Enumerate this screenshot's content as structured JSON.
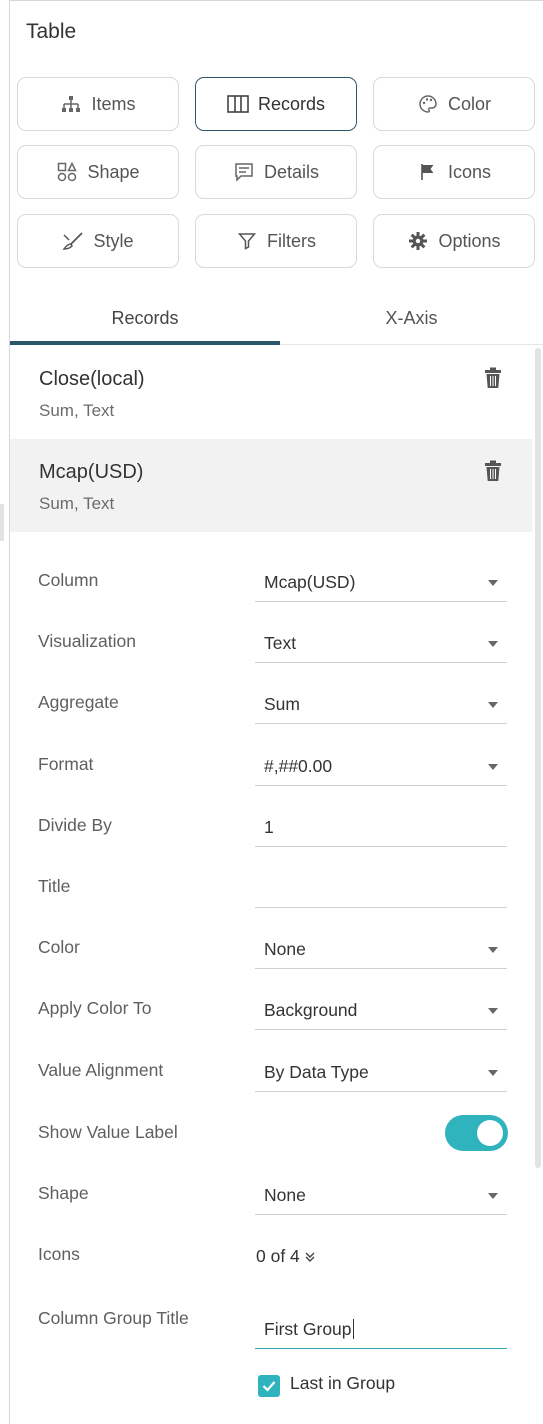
{
  "panel": {
    "title": "Table"
  },
  "buttons": [
    {
      "key": "items",
      "label": "Items",
      "icon": "hierarchy-icon",
      "active": false
    },
    {
      "key": "records",
      "label": "Records",
      "icon": "columns-icon",
      "active": true
    },
    {
      "key": "color",
      "label": "Color",
      "icon": "palette-icon",
      "active": false
    },
    {
      "key": "shape",
      "label": "Shape",
      "icon": "shapes-icon",
      "active": false
    },
    {
      "key": "details",
      "label": "Details",
      "icon": "comment-icon",
      "active": false
    },
    {
      "key": "icons",
      "label": "Icons",
      "icon": "flag-icon",
      "active": false
    },
    {
      "key": "style",
      "label": "Style",
      "icon": "brush-icon",
      "active": false
    },
    {
      "key": "filters",
      "label": "Filters",
      "icon": "filter-icon",
      "active": false
    },
    {
      "key": "options",
      "label": "Options",
      "icon": "gear-icon",
      "active": false
    }
  ],
  "tabs": [
    {
      "label": "Records",
      "active": true
    },
    {
      "label": "X-Axis",
      "active": false
    }
  ],
  "records": [
    {
      "name": "Close(local)",
      "sub": "Sum, Text",
      "selected": false
    },
    {
      "name": "Mcap(USD)",
      "sub": "Sum, Text",
      "selected": true
    }
  ],
  "properties": {
    "column": {
      "label": "Column",
      "value": "Mcap(USD)"
    },
    "visualization": {
      "label": "Visualization",
      "value": "Text"
    },
    "aggregate": {
      "label": "Aggregate",
      "value": "Sum"
    },
    "format": {
      "label": "Format",
      "value": "#,##0.00"
    },
    "divide_by": {
      "label": "Divide By",
      "value": "1"
    },
    "title": {
      "label": "Title",
      "value": ""
    },
    "color": {
      "label": "Color",
      "value": "None"
    },
    "apply_color_to": {
      "label": "Apply Color To",
      "value": "Background"
    },
    "value_alignment": {
      "label": "Value Alignment",
      "value": "By Data Type"
    },
    "show_value_label": {
      "label": "Show Value Label",
      "on": true
    },
    "shape": {
      "label": "Shape",
      "value": "None"
    },
    "icons": {
      "label": "Icons",
      "value": "0 of 4"
    },
    "column_group_title": {
      "label": "Column Group Title",
      "value": "First Group"
    },
    "last_in_group": {
      "label": "Last in Group",
      "checked": true
    }
  },
  "colors": {
    "accent": "#2a5868",
    "toggle": "#2fb3bd"
  }
}
